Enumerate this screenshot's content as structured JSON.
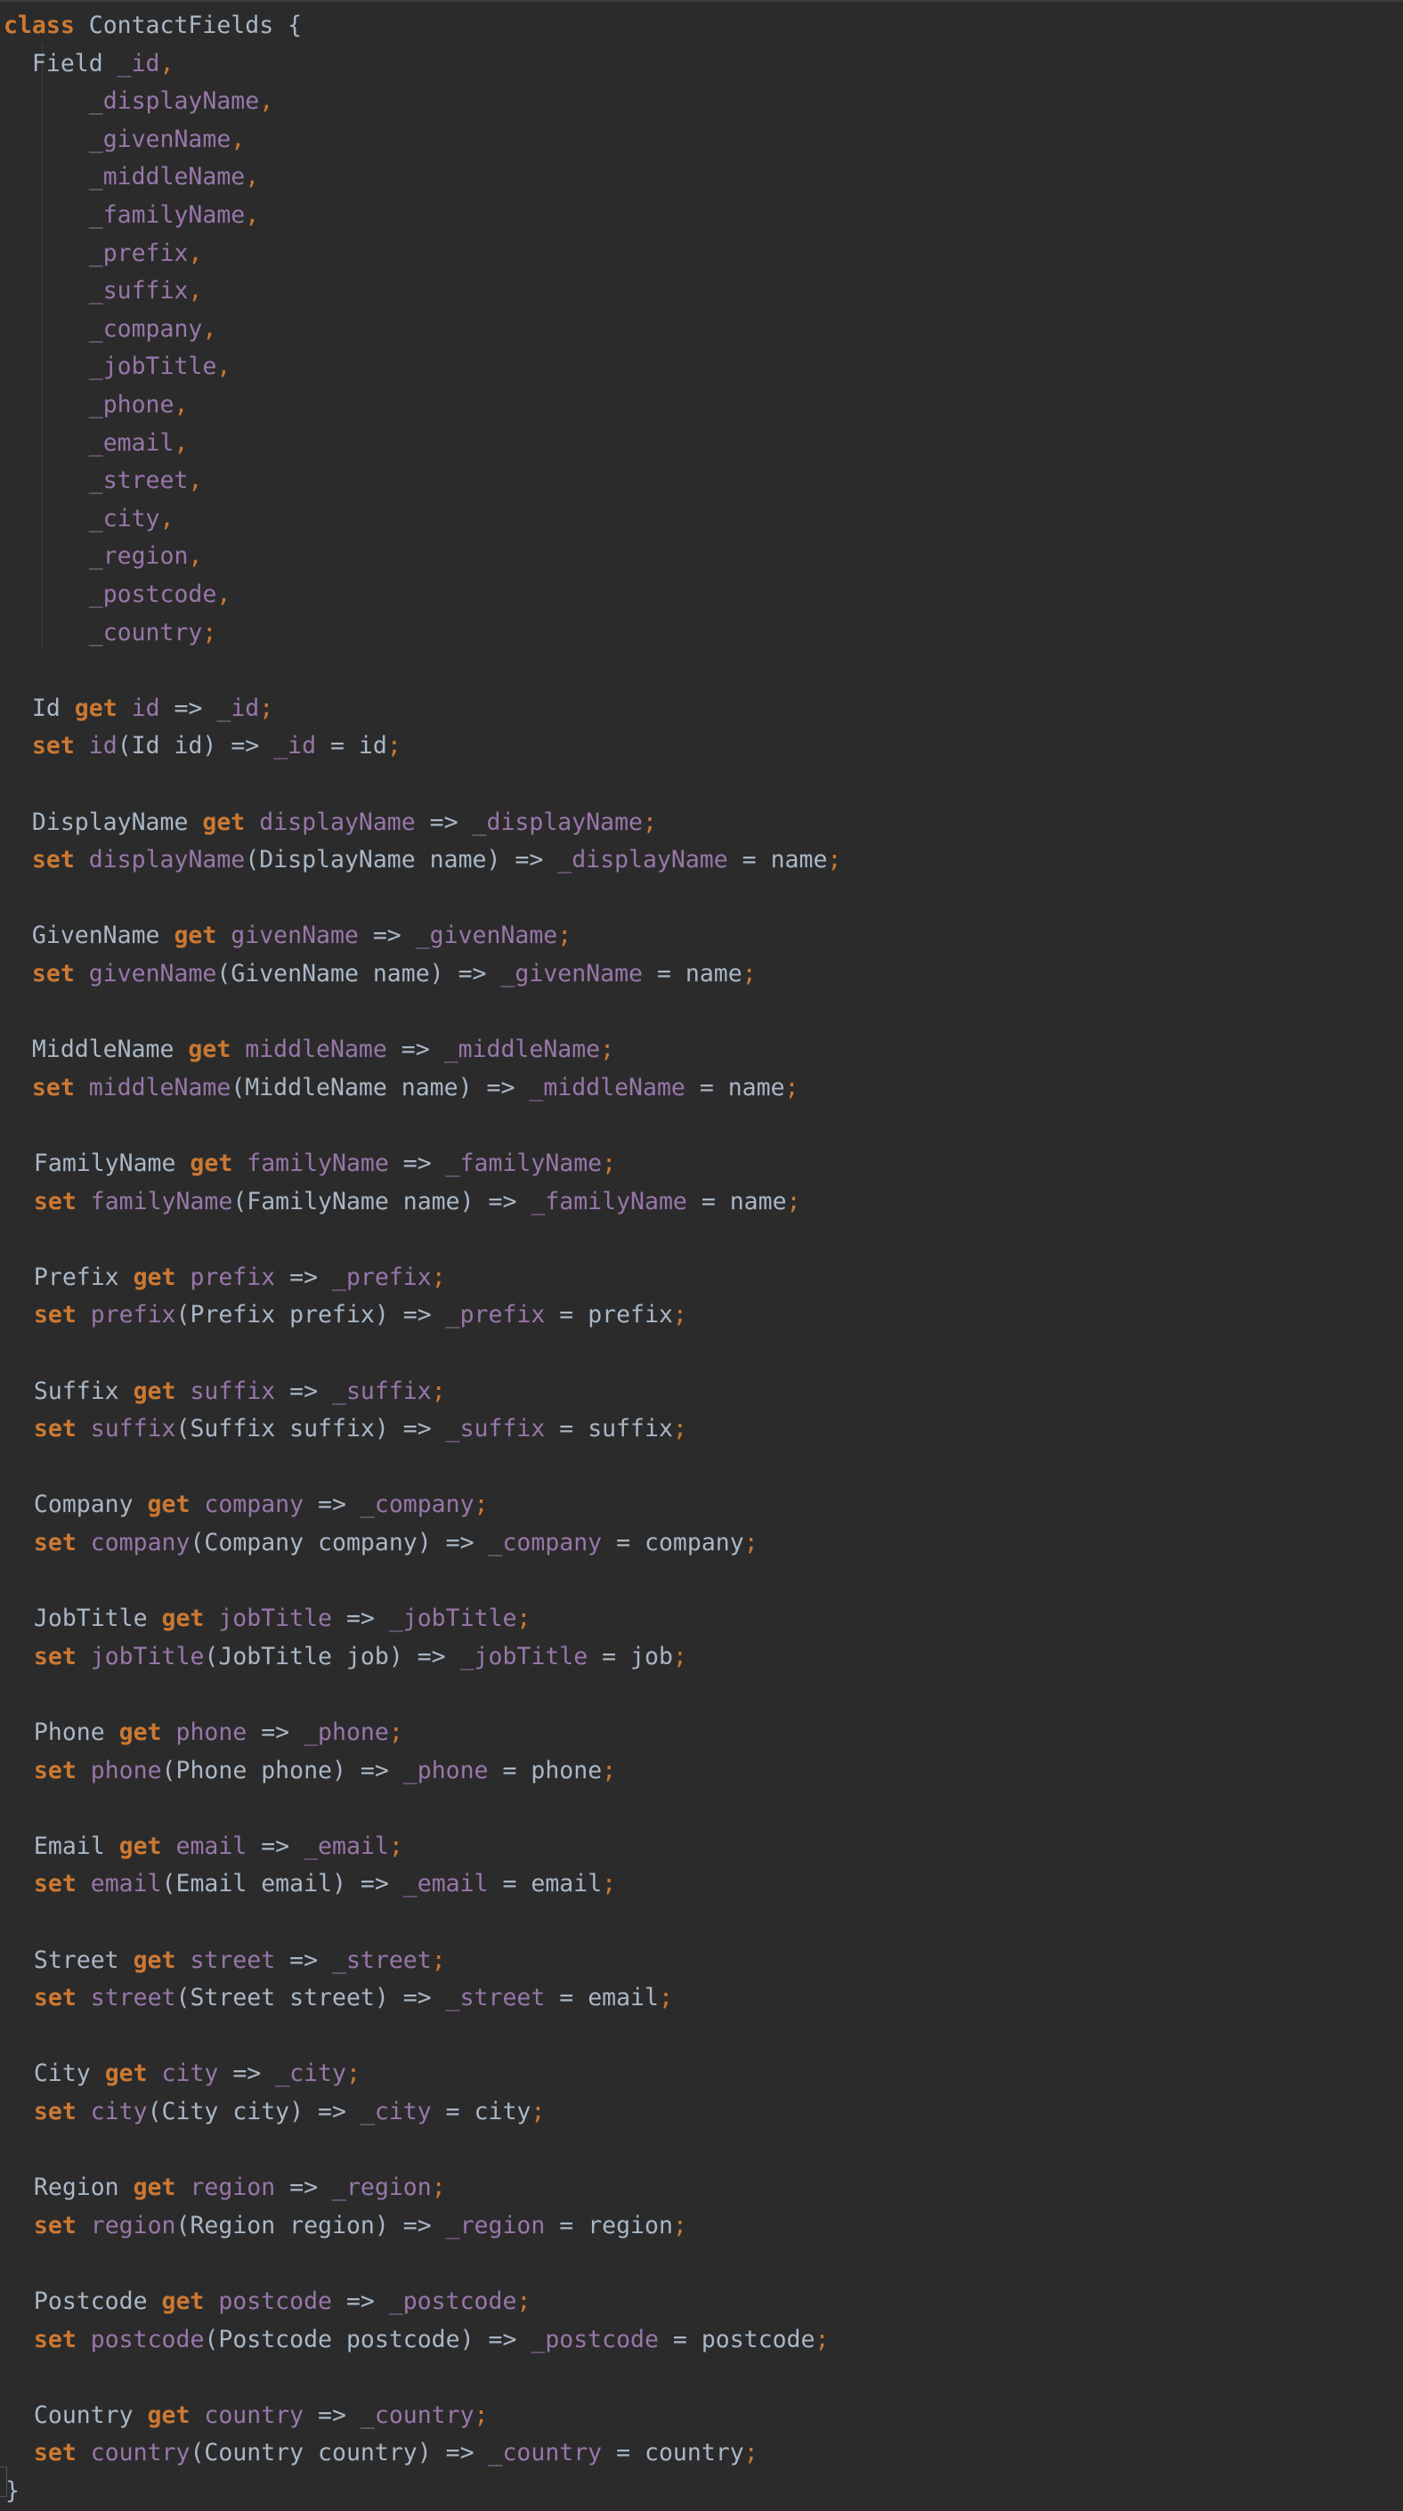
{
  "colors": {
    "background": "#2b2b2b",
    "keyword": "#cc7832",
    "field": "#9876aa",
    "text": "#a9b7c6"
  },
  "code_lines": [
    [
      [
        "k",
        "class"
      ],
      [
        "t",
        " ContactFields {"
      ]
    ],
    [
      [
        "t",
        "  Field "
      ],
      [
        "f",
        "_id"
      ],
      [
        "p",
        ","
      ]
    ],
    [
      [
        "t",
        "      "
      ],
      [
        "f",
        "_displayName"
      ],
      [
        "p",
        ","
      ]
    ],
    [
      [
        "t",
        "      "
      ],
      [
        "f",
        "_givenName"
      ],
      [
        "p",
        ","
      ]
    ],
    [
      [
        "t",
        "      "
      ],
      [
        "f",
        "_middleName"
      ],
      [
        "p",
        ","
      ]
    ],
    [
      [
        "t",
        "      "
      ],
      [
        "f",
        "_familyName"
      ],
      [
        "p",
        ","
      ]
    ],
    [
      [
        "t",
        "      "
      ],
      [
        "f",
        "_prefix"
      ],
      [
        "p",
        ","
      ]
    ],
    [
      [
        "t",
        "      "
      ],
      [
        "f",
        "_suffix"
      ],
      [
        "p",
        ","
      ]
    ],
    [
      [
        "t",
        "      "
      ],
      [
        "f",
        "_company"
      ],
      [
        "p",
        ","
      ]
    ],
    [
      [
        "t",
        "      "
      ],
      [
        "f",
        "_jobTitle"
      ],
      [
        "p",
        ","
      ]
    ],
    [
      [
        "t",
        "      "
      ],
      [
        "f",
        "_phone"
      ],
      [
        "p",
        ","
      ]
    ],
    [
      [
        "t",
        "      "
      ],
      [
        "f",
        "_email"
      ],
      [
        "p",
        ","
      ]
    ],
    [
      [
        "t",
        "      "
      ],
      [
        "f",
        "_street"
      ],
      [
        "p",
        ","
      ]
    ],
    [
      [
        "t",
        "      "
      ],
      [
        "f",
        "_city"
      ],
      [
        "p",
        ","
      ]
    ],
    [
      [
        "t",
        "      "
      ],
      [
        "f",
        "_region"
      ],
      [
        "p",
        ","
      ]
    ],
    [
      [
        "t",
        "      "
      ],
      [
        "f",
        "_postcode"
      ],
      [
        "p",
        ","
      ]
    ],
    [
      [
        "t",
        "      "
      ],
      [
        "f",
        "_country"
      ],
      [
        "p",
        ";"
      ]
    ],
    [],
    [
      [
        "t",
        "  Id "
      ],
      [
        "k",
        "get"
      ],
      [
        "t",
        " "
      ],
      [
        "f",
        "id"
      ],
      [
        "t",
        " => "
      ],
      [
        "f",
        "_id"
      ],
      [
        "p",
        ";"
      ]
    ],
    [
      [
        "t",
        "  "
      ],
      [
        "k",
        "set"
      ],
      [
        "t",
        " "
      ],
      [
        "f",
        "id"
      ],
      [
        "t",
        "(Id id) => "
      ],
      [
        "f",
        "_id"
      ],
      [
        "t",
        " = id"
      ],
      [
        "p",
        ";"
      ]
    ],
    [],
    [
      [
        "t",
        "  DisplayName "
      ],
      [
        "k",
        "get"
      ],
      [
        "t",
        " "
      ],
      [
        "f",
        "displayName"
      ],
      [
        "t",
        " => "
      ],
      [
        "f",
        "_displayName"
      ],
      [
        "p",
        ";"
      ]
    ],
    [
      [
        "t",
        "  "
      ],
      [
        "k",
        "set"
      ],
      [
        "t",
        " "
      ],
      [
        "f",
        "displayName"
      ],
      [
        "t",
        "(DisplayName name) => "
      ],
      [
        "f",
        "_displayName"
      ],
      [
        "t",
        " = name"
      ],
      [
        "p",
        ";"
      ]
    ],
    [],
    [
      [
        "t",
        "  GivenName "
      ],
      [
        "k",
        "get"
      ],
      [
        "t",
        " "
      ],
      [
        "f",
        "givenName"
      ],
      [
        "t",
        " => "
      ],
      [
        "f",
        "_givenName"
      ],
      [
        "p",
        ";"
      ]
    ],
    [
      [
        "t",
        "  "
      ],
      [
        "k",
        "set"
      ],
      [
        "t",
        " "
      ],
      [
        "f",
        "givenName"
      ],
      [
        "t",
        "(GivenName name) => "
      ],
      [
        "f",
        "_givenName"
      ],
      [
        "t",
        " = name"
      ],
      [
        "p",
        ";"
      ]
    ],
    [],
    [
      [
        "t",
        "  MiddleName "
      ],
      [
        "k",
        "get"
      ],
      [
        "t",
        " "
      ],
      [
        "f",
        "middleName"
      ],
      [
        "t",
        " => "
      ],
      [
        "f",
        "_middleName"
      ],
      [
        "p",
        ";"
      ]
    ],
    [
      [
        "t",
        "  "
      ],
      [
        "k",
        "set"
      ],
      [
        "t",
        " "
      ],
      [
        "f",
        "middleName"
      ],
      [
        "t",
        "(MiddleName name) => "
      ],
      [
        "f",
        "_middleName"
      ],
      [
        "t",
        " = name"
      ],
      [
        "p",
        ";"
      ]
    ],
    [],
    [
      [
        "t",
        "  FamilyName "
      ],
      [
        "k",
        "get"
      ],
      [
        "t",
        " "
      ],
      [
        "f",
        "familyName"
      ],
      [
        "t",
        " => "
      ],
      [
        "f",
        "_familyName"
      ],
      [
        "p",
        ";"
      ]
    ],
    [
      [
        "t",
        "  "
      ],
      [
        "k",
        "set"
      ],
      [
        "t",
        " "
      ],
      [
        "f",
        "familyName"
      ],
      [
        "t",
        "(FamilyName name) => "
      ],
      [
        "f",
        "_familyName"
      ],
      [
        "t",
        " = name"
      ],
      [
        "p",
        ";"
      ]
    ],
    [],
    [
      [
        "t",
        "  Prefix "
      ],
      [
        "k",
        "get"
      ],
      [
        "t",
        " "
      ],
      [
        "f",
        "prefix"
      ],
      [
        "t",
        " => "
      ],
      [
        "f",
        "_prefix"
      ],
      [
        "p",
        ";"
      ]
    ],
    [
      [
        "t",
        "  "
      ],
      [
        "k",
        "set"
      ],
      [
        "t",
        " "
      ],
      [
        "f",
        "prefix"
      ],
      [
        "t",
        "(Prefix prefix) => "
      ],
      [
        "f",
        "_prefix"
      ],
      [
        "t",
        " = prefix"
      ],
      [
        "p",
        ";"
      ]
    ],
    [],
    [
      [
        "t",
        "  Suffix "
      ],
      [
        "k",
        "get"
      ],
      [
        "t",
        " "
      ],
      [
        "f",
        "suffix"
      ],
      [
        "t",
        " => "
      ],
      [
        "f",
        "_suffix"
      ],
      [
        "p",
        ";"
      ]
    ],
    [
      [
        "t",
        "  "
      ],
      [
        "k",
        "set"
      ],
      [
        "t",
        " "
      ],
      [
        "f",
        "suffix"
      ],
      [
        "t",
        "(Suffix suffix) => "
      ],
      [
        "f",
        "_suffix"
      ],
      [
        "t",
        " = suffix"
      ],
      [
        "p",
        ";"
      ]
    ],
    [],
    [
      [
        "t",
        "  Company "
      ],
      [
        "k",
        "get"
      ],
      [
        "t",
        " "
      ],
      [
        "f",
        "company"
      ],
      [
        "t",
        " => "
      ],
      [
        "f",
        "_company"
      ],
      [
        "p",
        ";"
      ]
    ],
    [
      [
        "t",
        "  "
      ],
      [
        "k",
        "set"
      ],
      [
        "t",
        " "
      ],
      [
        "f",
        "company"
      ],
      [
        "t",
        "(Company company) => "
      ],
      [
        "f",
        "_company"
      ],
      [
        "t",
        " = company"
      ],
      [
        "p",
        ";"
      ]
    ],
    [],
    [
      [
        "t",
        "  JobTitle "
      ],
      [
        "k",
        "get"
      ],
      [
        "t",
        " "
      ],
      [
        "f",
        "jobTitle"
      ],
      [
        "t",
        " => "
      ],
      [
        "f",
        "_jobTitle"
      ],
      [
        "p",
        ";"
      ]
    ],
    [
      [
        "t",
        "  "
      ],
      [
        "k",
        "set"
      ],
      [
        "t",
        " "
      ],
      [
        "f",
        "jobTitle"
      ],
      [
        "t",
        "(JobTitle job) => "
      ],
      [
        "f",
        "_jobTitle"
      ],
      [
        "t",
        " = job"
      ],
      [
        "p",
        ";"
      ]
    ],
    [],
    [
      [
        "t",
        "  Phone "
      ],
      [
        "k",
        "get"
      ],
      [
        "t",
        " "
      ],
      [
        "f",
        "phone"
      ],
      [
        "t",
        " => "
      ],
      [
        "f",
        "_phone"
      ],
      [
        "p",
        ";"
      ]
    ],
    [
      [
        "t",
        "  "
      ],
      [
        "k",
        "set"
      ],
      [
        "t",
        " "
      ],
      [
        "f",
        "phone"
      ],
      [
        "t",
        "(Phone phone) => "
      ],
      [
        "f",
        "_phone"
      ],
      [
        "t",
        " = phone"
      ],
      [
        "p",
        ";"
      ]
    ],
    [],
    [
      [
        "t",
        "  Email "
      ],
      [
        "k",
        "get"
      ],
      [
        "t",
        " "
      ],
      [
        "f",
        "email"
      ],
      [
        "t",
        " => "
      ],
      [
        "f",
        "_email"
      ],
      [
        "p",
        ";"
      ]
    ],
    [
      [
        "t",
        "  "
      ],
      [
        "k",
        "set"
      ],
      [
        "t",
        " "
      ],
      [
        "f",
        "email"
      ],
      [
        "t",
        "(Email email) => "
      ],
      [
        "f",
        "_email"
      ],
      [
        "t",
        " = email"
      ],
      [
        "p",
        ";"
      ]
    ],
    [],
    [
      [
        "t",
        "  Street "
      ],
      [
        "k",
        "get"
      ],
      [
        "t",
        " "
      ],
      [
        "f",
        "street"
      ],
      [
        "t",
        " => "
      ],
      [
        "f",
        "_street"
      ],
      [
        "p",
        ";"
      ]
    ],
    [
      [
        "t",
        "  "
      ],
      [
        "k",
        "set"
      ],
      [
        "t",
        " "
      ],
      [
        "f",
        "street"
      ],
      [
        "t",
        "(Street street) => "
      ],
      [
        "f",
        "_street"
      ],
      [
        "t",
        " = email"
      ],
      [
        "p",
        ";"
      ]
    ],
    [],
    [
      [
        "t",
        "  City "
      ],
      [
        "k",
        "get"
      ],
      [
        "t",
        " "
      ],
      [
        "f",
        "city"
      ],
      [
        "t",
        " => "
      ],
      [
        "f",
        "_city"
      ],
      [
        "p",
        ";"
      ]
    ],
    [
      [
        "t",
        "  "
      ],
      [
        "k",
        "set"
      ],
      [
        "t",
        " "
      ],
      [
        "f",
        "city"
      ],
      [
        "t",
        "(City city) => "
      ],
      [
        "f",
        "_city"
      ],
      [
        "t",
        " = city"
      ],
      [
        "p",
        ";"
      ]
    ],
    [],
    [
      [
        "t",
        "  Region "
      ],
      [
        "k",
        "get"
      ],
      [
        "t",
        " "
      ],
      [
        "f",
        "region"
      ],
      [
        "t",
        " => "
      ],
      [
        "f",
        "_region"
      ],
      [
        "p",
        ";"
      ]
    ],
    [
      [
        "t",
        "  "
      ],
      [
        "k",
        "set"
      ],
      [
        "t",
        " "
      ],
      [
        "f",
        "region"
      ],
      [
        "t",
        "(Region region) => "
      ],
      [
        "f",
        "_region"
      ],
      [
        "t",
        " = region"
      ],
      [
        "p",
        ";"
      ]
    ],
    [],
    [
      [
        "t",
        "  Postcode "
      ],
      [
        "k",
        "get"
      ],
      [
        "t",
        " "
      ],
      [
        "f",
        "postcode"
      ],
      [
        "t",
        " => "
      ],
      [
        "f",
        "_postcode"
      ],
      [
        "p",
        ";"
      ]
    ],
    [
      [
        "t",
        "  "
      ],
      [
        "k",
        "set"
      ],
      [
        "t",
        " "
      ],
      [
        "f",
        "postcode"
      ],
      [
        "t",
        "(Postcode postcode) => "
      ],
      [
        "f",
        "_postcode"
      ],
      [
        "t",
        " = postcode"
      ],
      [
        "p",
        ";"
      ]
    ],
    [],
    [
      [
        "t",
        "  Country "
      ],
      [
        "k",
        "get"
      ],
      [
        "t",
        " "
      ],
      [
        "f",
        "country"
      ],
      [
        "t",
        " => "
      ],
      [
        "f",
        "_country"
      ],
      [
        "p",
        ";"
      ]
    ],
    [
      [
        "t",
        "  "
      ],
      [
        "k",
        "set"
      ],
      [
        "t",
        " "
      ],
      [
        "f",
        "country"
      ],
      [
        "t",
        "(Country country) => "
      ],
      [
        "f",
        "_country"
      ],
      [
        "t",
        " = country"
      ],
      [
        "p",
        ";"
      ]
    ],
    [
      [
        "t",
        "}"
      ]
    ]
  ]
}
